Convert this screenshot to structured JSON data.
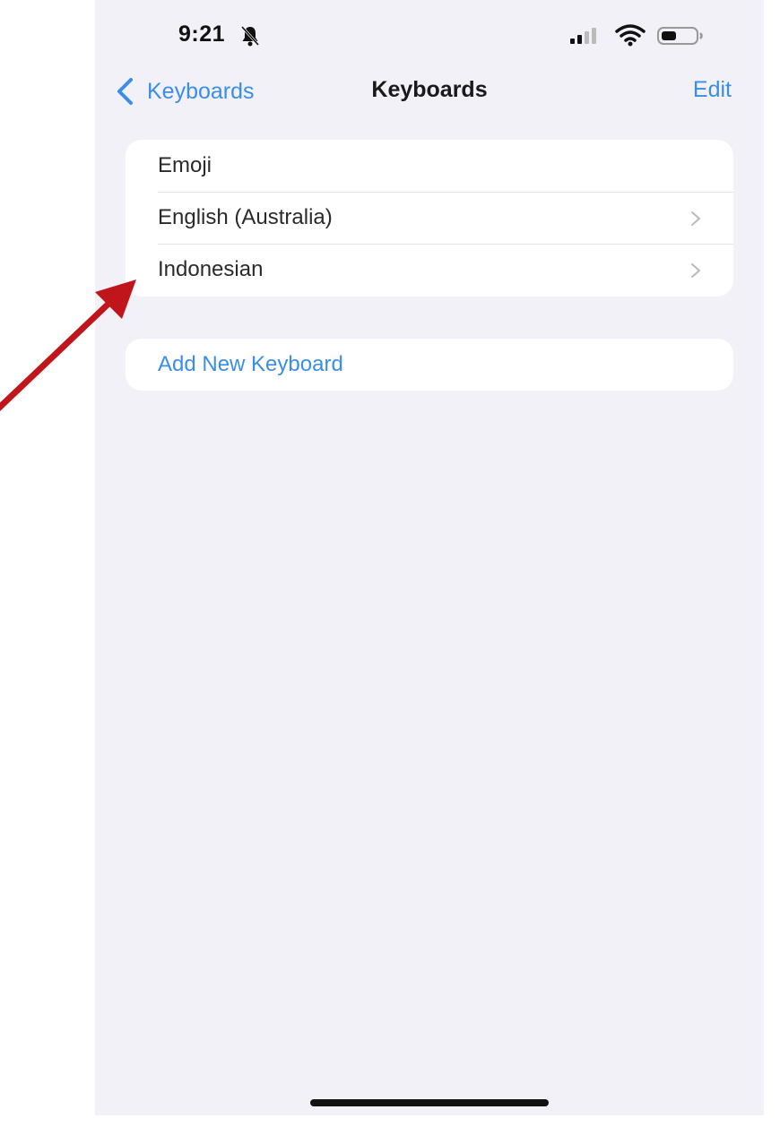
{
  "status_bar": {
    "time": "9:21",
    "icons": [
      "bell-slash-icon",
      "cellular-signal-icon",
      "wifi-icon",
      "battery-icon"
    ]
  },
  "nav": {
    "back_label": "Keyboards",
    "title": "Keyboards",
    "edit_label": "Edit",
    "back_icon": "chevron-left-icon"
  },
  "keyboards": [
    {
      "label": "Emoji",
      "has_chevron": false
    },
    {
      "label": "English (Australia)",
      "has_chevron": true
    },
    {
      "label": "Indonesian",
      "has_chevron": true
    }
  ],
  "add_keyboard": {
    "label": "Add New Keyboard"
  },
  "annotation": {
    "type": "arrow",
    "color": "#c0161b",
    "points_to": "Indonesian"
  },
  "colors": {
    "accent": "#3a8ee6",
    "background": "#f2f1f7",
    "card": "#ffffff"
  }
}
